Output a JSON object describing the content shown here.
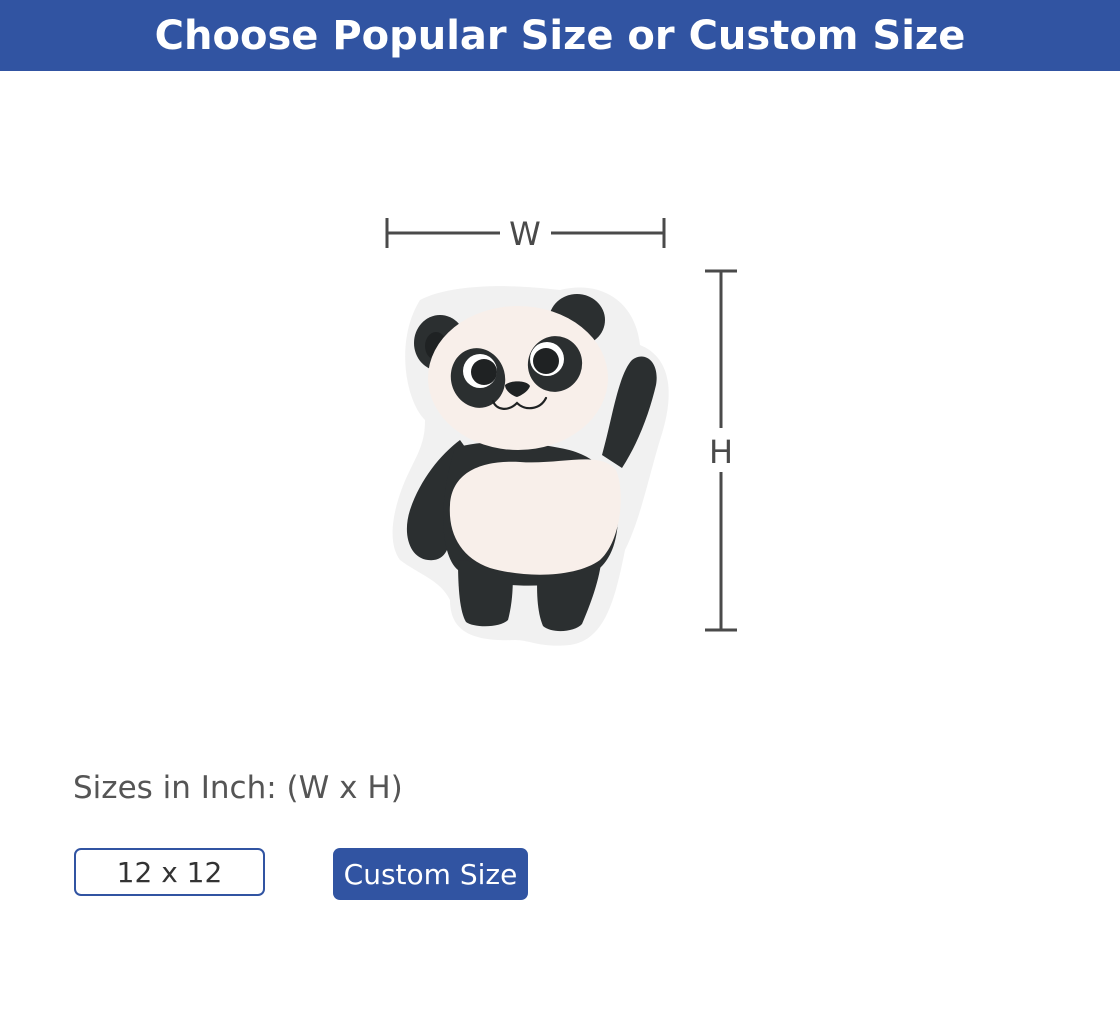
{
  "header": {
    "title": "Choose Popular Size or Custom Size"
  },
  "diagram": {
    "width_label": "W",
    "height_label": "H",
    "image": "panda-sticker"
  },
  "sizes": {
    "label": "Sizes in Inch: (W x H)",
    "options": [
      {
        "label": "12 x 12"
      }
    ],
    "custom_button_label": "Custom Size"
  },
  "colors": {
    "brand": "#3154a2",
    "panda_dark": "#2b2f30",
    "panda_light": "#f8efea",
    "sticker_border": "#f1f1f1",
    "dimension_line": "#4a4a4a"
  }
}
